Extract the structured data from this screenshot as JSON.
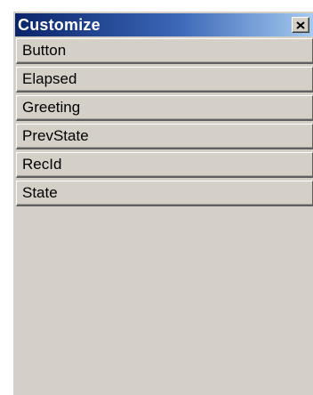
{
  "window": {
    "title": "Customize",
    "close_icon": "close-icon",
    "colors": {
      "titlebar_start": "#0a246a",
      "titlebar_end": "#a6caf0",
      "face": "#d4d0c8"
    }
  },
  "items": [
    {
      "label": "Button"
    },
    {
      "label": "Elapsed"
    },
    {
      "label": "Greeting"
    },
    {
      "label": "PrevState"
    },
    {
      "label": "RecId"
    },
    {
      "label": "State"
    }
  ]
}
